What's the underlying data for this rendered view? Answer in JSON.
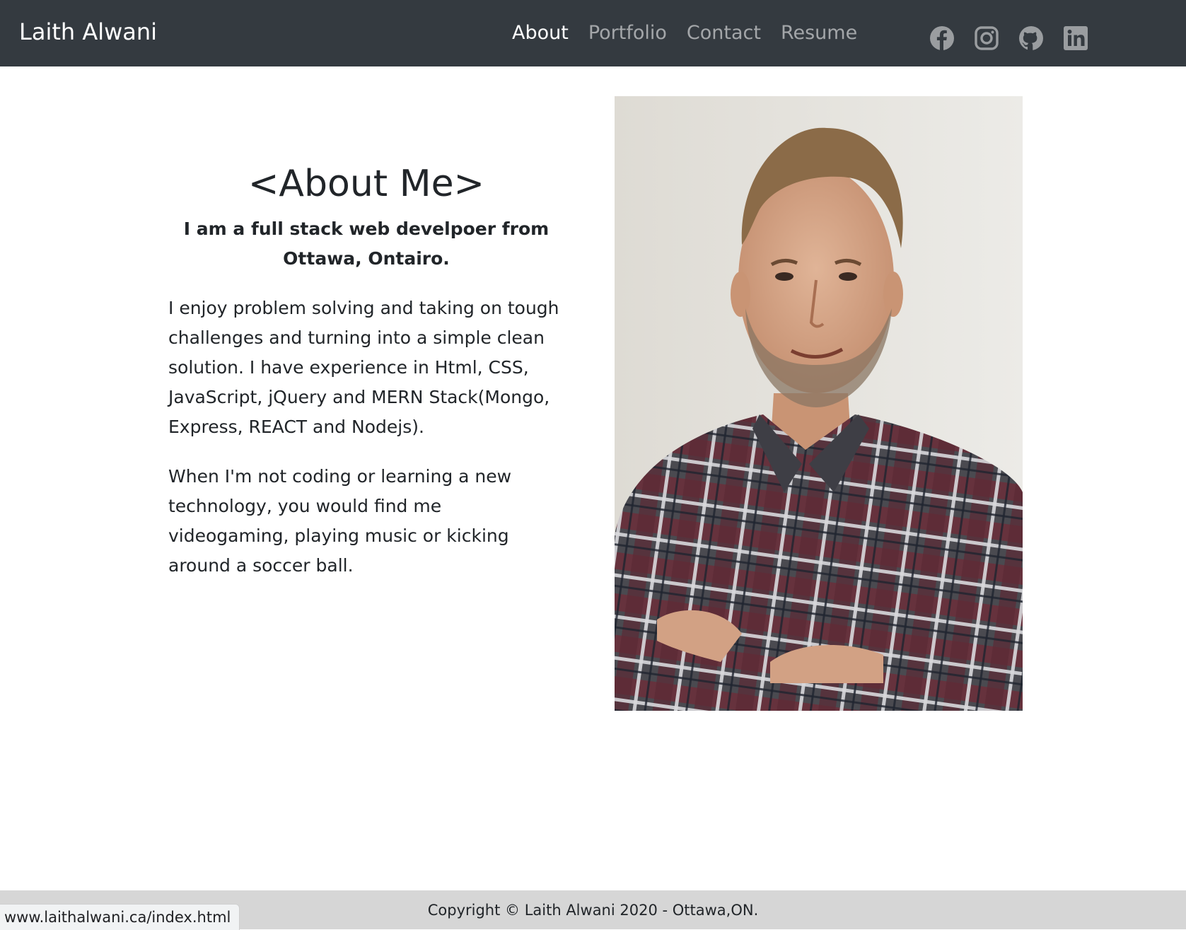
{
  "nav": {
    "brand": "Laith Alwani",
    "links": [
      {
        "label": "About",
        "active": true
      },
      {
        "label": "Portfolio",
        "active": false
      },
      {
        "label": "Contact",
        "active": false
      },
      {
        "label": "Resume",
        "active": false
      }
    ],
    "social_icons": [
      "facebook-icon",
      "instagram-icon",
      "github-icon",
      "linkedin-icon"
    ]
  },
  "about": {
    "title": "<About Me>",
    "lead": "I am a full stack web develpoer from Ottawa, Ontairo.",
    "paragraphs": [
      "I enjoy problem solving and taking on tough challenges and turning into a simple clean solution. I have experience in Html, CSS, JavaScript, jQuery and MERN Stack(Mongo, Express, REACT and Nodejs).",
      "When I'm not coding or learning a new technology, you would find me videogaming, playing music or kicking around a soccer ball."
    ]
  },
  "footer": {
    "copyright": "Copyright © Laith Alwani 2020 - Ottawa,ON."
  },
  "status_bar": {
    "url": "www.laithalwani.ca/index.html"
  },
  "colors": {
    "navbar_bg": "#343a40",
    "nav_active": "#ffffff",
    "nav_inactive": "#9a9da0",
    "footer_bg": "#d6d6d6",
    "text": "#212529"
  }
}
